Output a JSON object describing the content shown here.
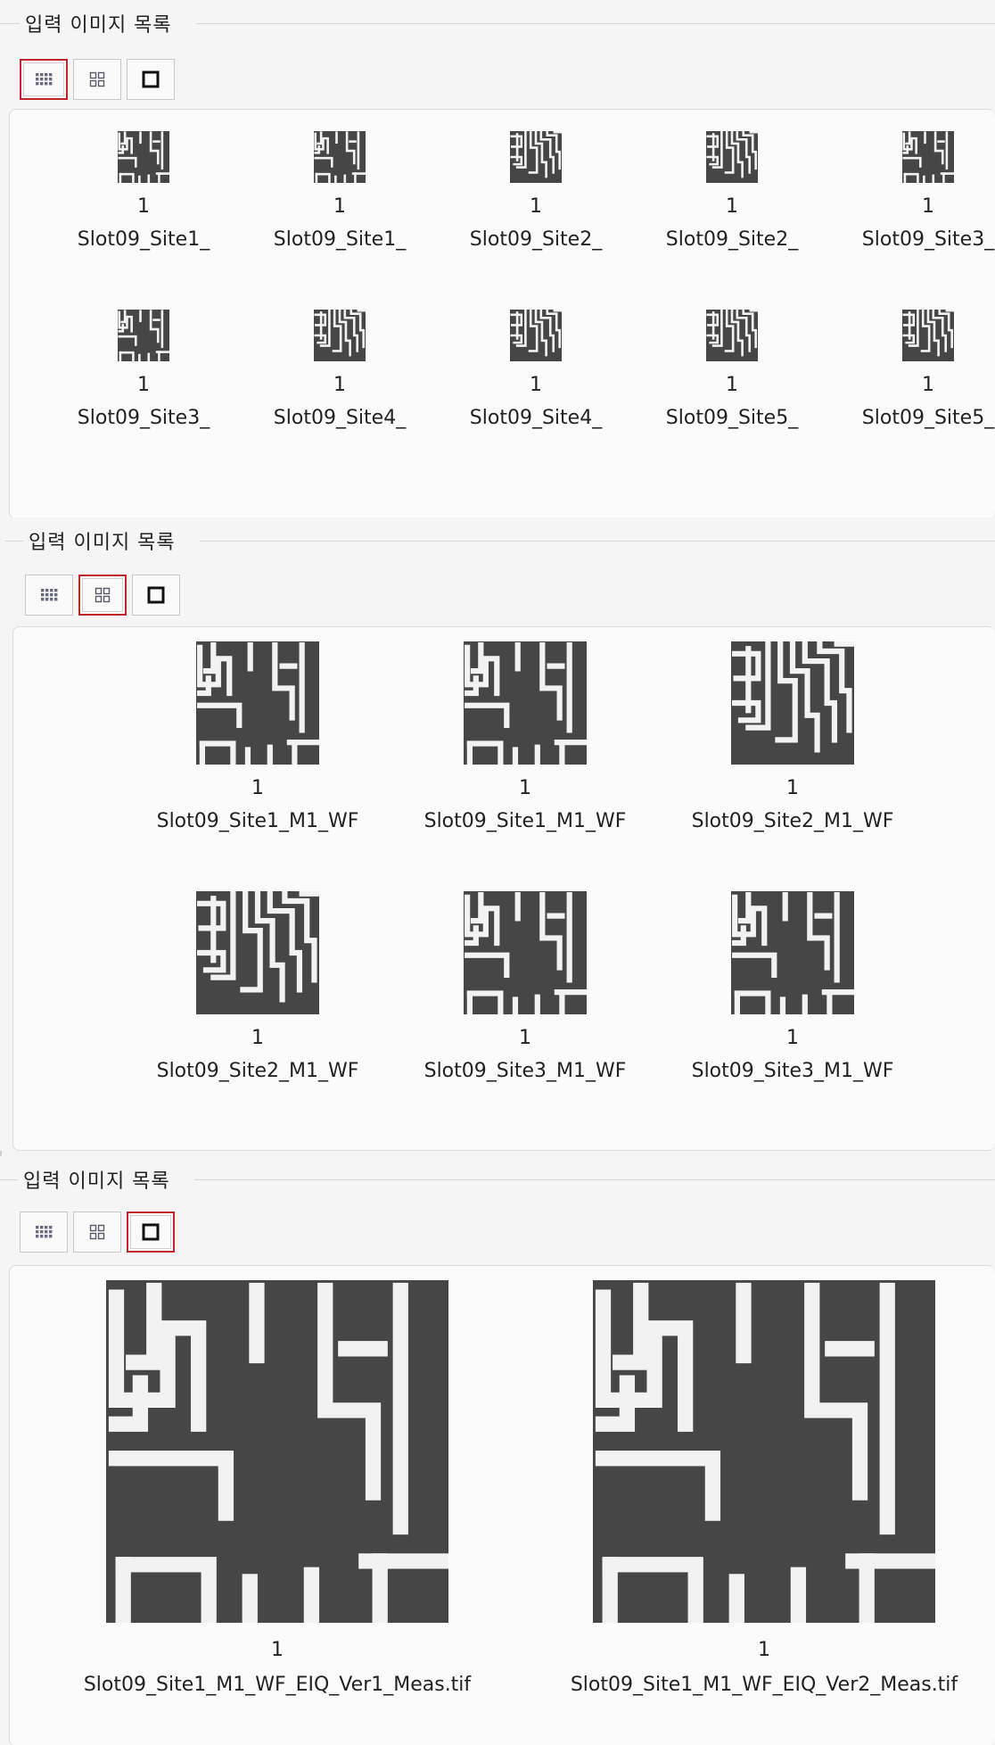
{
  "group_title": "입력 이미지 목록",
  "view_modes": [
    {
      "name": "small-grid",
      "icon": "grid-small-icon"
    },
    {
      "name": "medium-grid",
      "icon": "grid-medium-icon"
    },
    {
      "name": "large-single",
      "icon": "square-icon"
    }
  ],
  "sections": [
    {
      "selected_mode": "small-grid",
      "items": [
        {
          "count": "1",
          "name": "Slot09_Site1_",
          "pattern": "A"
        },
        {
          "count": "1",
          "name": "Slot09_Site1_",
          "pattern": "A"
        },
        {
          "count": "1",
          "name": "Slot09_Site2_",
          "pattern": "B"
        },
        {
          "count": "1",
          "name": "Slot09_Site2_",
          "pattern": "B"
        },
        {
          "count": "1",
          "name": "Slot09_Site3_",
          "pattern": "A"
        },
        {
          "count": "1",
          "name": "Slot09_Site3_",
          "pattern": "A"
        },
        {
          "count": "1",
          "name": "Slot09_Site4_",
          "pattern": "B"
        },
        {
          "count": "1",
          "name": "Slot09_Site4_",
          "pattern": "B"
        },
        {
          "count": "1",
          "name": "Slot09_Site5_",
          "pattern": "B"
        },
        {
          "count": "1",
          "name": "Slot09_Site5_",
          "pattern": "B"
        }
      ]
    },
    {
      "selected_mode": "medium-grid",
      "items": [
        {
          "count": "1",
          "name": "Slot09_Site1_M1_WF",
          "pattern": "A"
        },
        {
          "count": "1",
          "name": "Slot09_Site1_M1_WF",
          "pattern": "A"
        },
        {
          "count": "1",
          "name": "Slot09_Site2_M1_WF",
          "pattern": "B"
        },
        {
          "count": "1",
          "name": "Slot09_Site2_M1_WF",
          "pattern": "B"
        },
        {
          "count": "1",
          "name": "Slot09_Site3_M1_WF",
          "pattern": "A"
        },
        {
          "count": "1",
          "name": "Slot09_Site3_M1_WF",
          "pattern": "A"
        }
      ]
    },
    {
      "selected_mode": "large-single",
      "items": [
        {
          "count": "1",
          "name": "Slot09_Site1_M1_WF_EIQ_Ver1_Meas.tif",
          "pattern": "A"
        },
        {
          "count": "1",
          "name": "Slot09_Site1_M1_WF_EIQ_Ver2_Meas.tif",
          "pattern": "A"
        }
      ]
    }
  ],
  "colors": {
    "accent_selected": "#c0272d",
    "thumb_bg": "#464646",
    "thumb_line": "#f2f2f2"
  }
}
